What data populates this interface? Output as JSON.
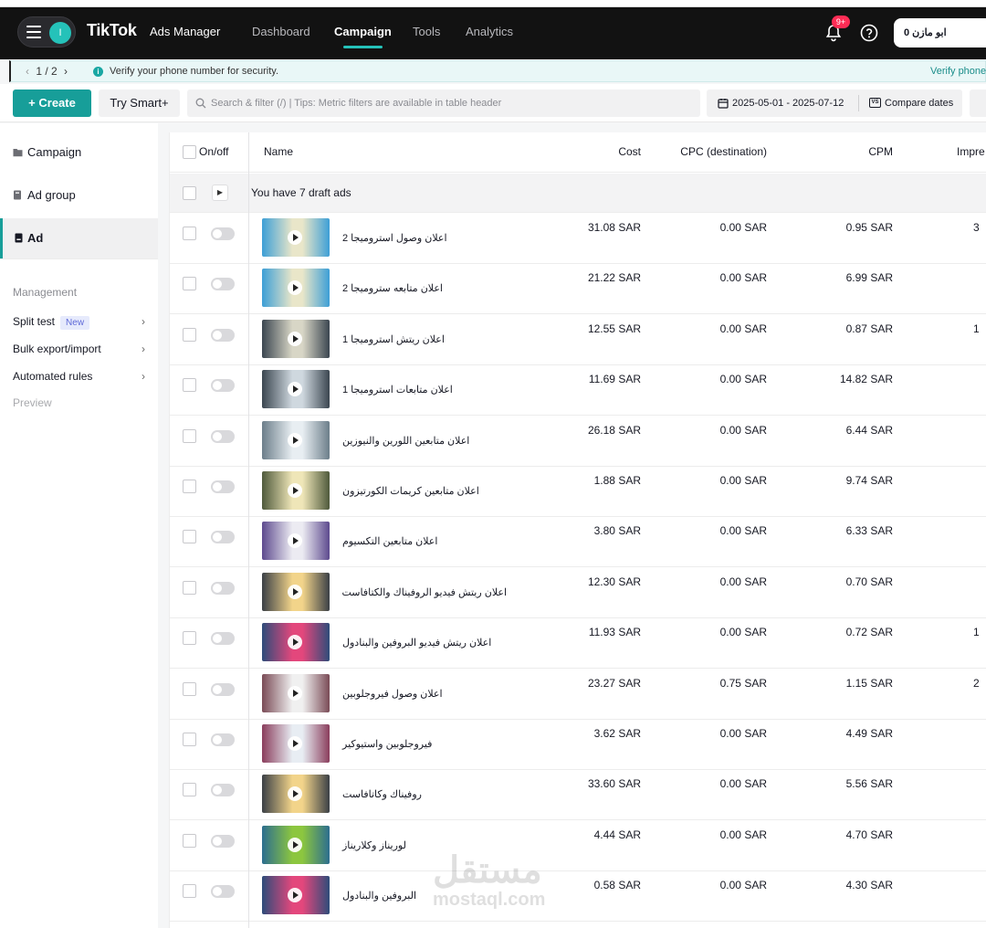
{
  "topbar": {
    "account_initial": "I",
    "brand": "TikTok",
    "brand_sub": "Ads Manager",
    "nav": [
      "Dashboard",
      "Campaign",
      "Tools",
      "Analytics"
    ],
    "active_nav": "Campaign",
    "notification_badge": "9+",
    "account_name": "ابو مازن 0"
  },
  "notice": {
    "pager": "1 / 2",
    "message": "Verify your phone number for security.",
    "link": "Verify phone"
  },
  "toolbar": {
    "create": "Create",
    "try_smart": "Try Smart+",
    "search_placeholder": "Search & filter (/) | Tips: Metric filters are available in table header",
    "date_range": "2025-05-01 - 2025-07-12",
    "compare": "Compare dates",
    "compare_icon_text": "VS"
  },
  "sidebar": {
    "levels": [
      "Campaign",
      "Ad group",
      "Ad"
    ],
    "active_level": "Ad",
    "management_label": "Management",
    "menu": [
      {
        "label": "Split test",
        "tag": "New"
      },
      {
        "label": "Bulk export/import",
        "tag": ""
      },
      {
        "label": "Automated rules",
        "tag": ""
      }
    ],
    "preview": "Preview"
  },
  "table": {
    "headers": {
      "onoff": "On/off",
      "name": "Name",
      "cost": "Cost",
      "cpc": "CPC (destination)",
      "cpm": "CPM",
      "impressions": "Impre"
    },
    "draft_message": "You have 7 draft ads",
    "rows": [
      {
        "name": "اعلان وصول استروميجا 2",
        "cost": "31.08 SAR",
        "cpc": "0.00 SAR",
        "cpm": "0.95 SAR",
        "edge": "3",
        "thumb": [
          "#3d9fd6",
          "#e9e6c9"
        ]
      },
      {
        "name": "اعلان متابعه ستروميجا 2",
        "cost": "21.22 SAR",
        "cpc": "0.00 SAR",
        "cpm": "6.99 SAR",
        "edge": "",
        "thumb": [
          "#3d9fd6",
          "#e9e6c9"
        ]
      },
      {
        "name": "اعلان ريتش استروميجا 1",
        "cost": "12.55 SAR",
        "cpc": "0.00 SAR",
        "cpm": "0.87 SAR",
        "edge": "1",
        "thumb": [
          "#3b4650",
          "#d8d6c6"
        ]
      },
      {
        "name": "اعلان متابعات استروميجا 1",
        "cost": "11.69 SAR",
        "cpc": "0.00 SAR",
        "cpm": "14.82 SAR",
        "edge": "",
        "thumb": [
          "#3b4650",
          "#cfd8df"
        ]
      },
      {
        "name": "اعلان متابعين اللورين والنيوزين",
        "cost": "26.18 SAR",
        "cpc": "0.00 SAR",
        "cpm": "6.44 SAR",
        "edge": "",
        "thumb": [
          "#6c7e8a",
          "#e8eef2"
        ]
      },
      {
        "name": "اعلان متابعين كريمات الكورتيزون",
        "cost": "1.88 SAR",
        "cpc": "0.00 SAR",
        "cpm": "9.74 SAR",
        "edge": "",
        "thumb": [
          "#4f5a3c",
          "#efe6b8"
        ]
      },
      {
        "name": "اعلان متابعين التكسيوم",
        "cost": "3.80 SAR",
        "cpc": "0.00 SAR",
        "cpm": "6.33 SAR",
        "edge": "",
        "thumb": [
          "#5d4a8e",
          "#ecebf2"
        ]
      },
      {
        "name": "اعلان ريتش فيديو الروفيناك والكتافاست",
        "cost": "12.30 SAR",
        "cpc": "0.00 SAR",
        "cpm": "0.70 SAR",
        "edge": "",
        "thumb": [
          "#3b4046",
          "#f2d48a"
        ]
      },
      {
        "name": "اعلان ريتش فيديو البروفين والبنادول",
        "cost": "11.93 SAR",
        "cpc": "0.00 SAR",
        "cpm": "0.72 SAR",
        "edge": "1",
        "thumb": [
          "#2e4c7a",
          "#e3477c"
        ]
      },
      {
        "name": "اعلان وصول فيروجلوبين",
        "cost": "23.27 SAR",
        "cpc": "0.75 SAR",
        "cpm": "1.15 SAR",
        "edge": "2",
        "thumb": [
          "#7a4b56",
          "#f0f0f0"
        ]
      },
      {
        "name": "فيروجلوبين واستيوكير",
        "cost": "3.62 SAR",
        "cpc": "0.00 SAR",
        "cpm": "4.49 SAR",
        "edge": "",
        "thumb": [
          "#8a3d5c",
          "#e8edf3"
        ]
      },
      {
        "name": "روفيناك وكاتافاست",
        "cost": "33.60 SAR",
        "cpc": "0.00 SAR",
        "cpm": "5.56 SAR",
        "edge": "",
        "thumb": [
          "#3b4046",
          "#f2d48a"
        ]
      },
      {
        "name": "لوريناز وكلاريناز",
        "cost": "4.44 SAR",
        "cpc": "0.00 SAR",
        "cpm": "4.70 SAR",
        "edge": "",
        "thumb": [
          "#2c6e8f",
          "#8cc63f"
        ]
      },
      {
        "name": "البروفين والبنادول",
        "cost": "0.58 SAR",
        "cpc": "0.00 SAR",
        "cpm": "4.30 SAR",
        "edge": "",
        "thumb": [
          "#2e4c7a",
          "#e3477c"
        ]
      }
    ]
  },
  "watermark": {
    "arabic": "مستقل",
    "latin": "mostaql.com"
  },
  "colors": {
    "accent": "#179e99",
    "topbar": "#121212",
    "badge": "#fe2c55"
  }
}
